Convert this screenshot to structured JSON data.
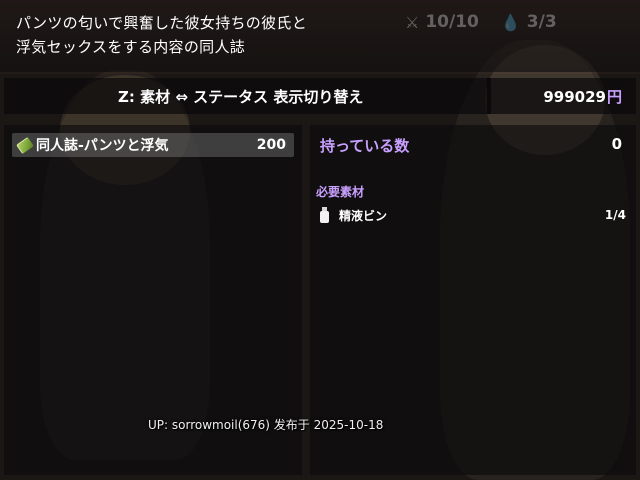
{
  "title": {
    "line1": "パンツの匂いで興奮した彼女持ちの彼氏と",
    "line2": "浮気セックスをする内容の同人誌"
  },
  "counters": {
    "first_icon": "swords-icon",
    "first_value": "10/10",
    "second_icon": "droplet-icon",
    "second_value": "3/3"
  },
  "help": {
    "toggle_text": "Z: 素材 ⇔ ステータス 表示切り替え",
    "gold_value": "999029",
    "gold_unit": "円"
  },
  "item_list": [
    {
      "icon": "book-icon",
      "name": "同人誌-パンツと浮気",
      "count": "200",
      "selected": true
    }
  ],
  "detail": {
    "owned_label": "持っている数",
    "owned_value": "0",
    "required_heading": "必要素材",
    "materials": [
      {
        "icon": "bottle-icon",
        "name": "精液ビン",
        "count": "1/4"
      }
    ]
  },
  "uploader_text": "UP: sorrowmoil(676) 发布于 2025-10-18",
  "colors": {
    "accent": "#c9a0ff",
    "panel": "#0a0a0c",
    "text": "#ffffff"
  }
}
